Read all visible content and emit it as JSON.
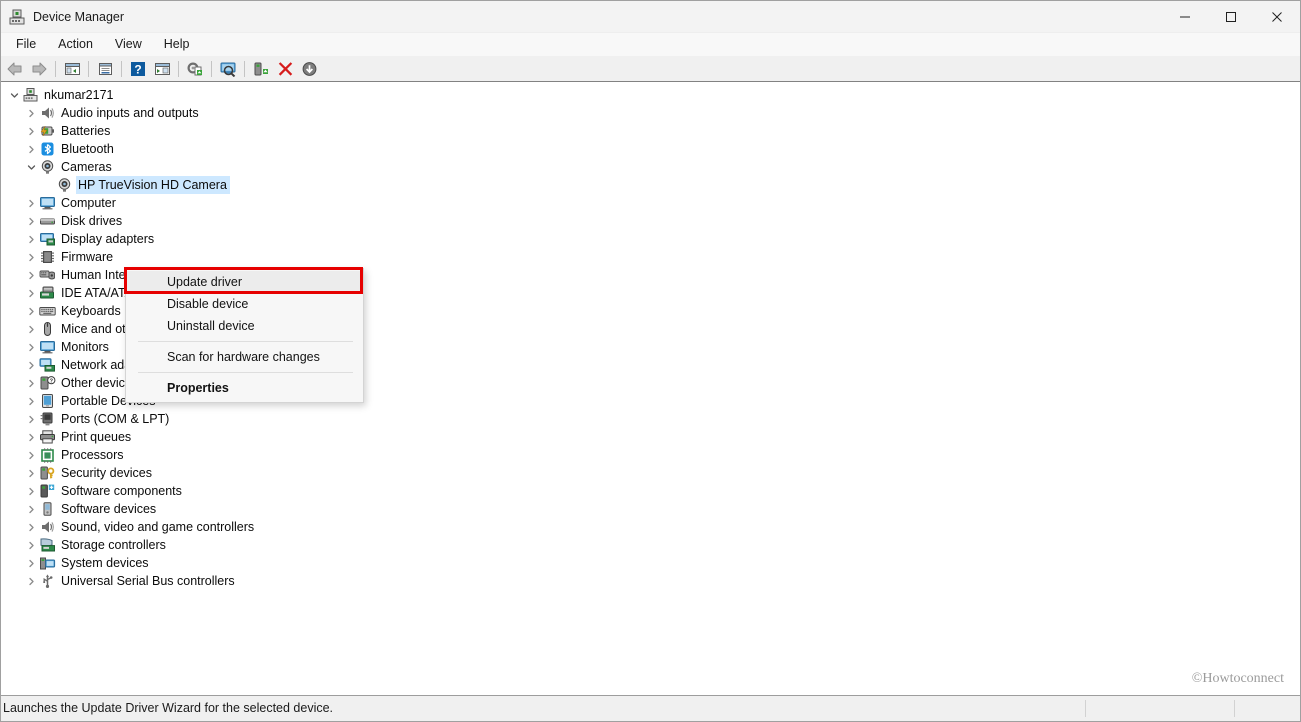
{
  "window": {
    "title": "Device Manager",
    "title_icon": "device-manager-icon",
    "minimize_label": "Minimize",
    "maximize_label": "Maximize",
    "close_label": "Close"
  },
  "menubar": {
    "items": [
      {
        "label": "File"
      },
      {
        "label": "Action"
      },
      {
        "label": "View"
      },
      {
        "label": "Help"
      }
    ]
  },
  "toolbar": {
    "items": [
      {
        "name": "back-arrow-icon",
        "tooltip": "Back"
      },
      {
        "name": "forward-arrow-icon",
        "tooltip": "Forward"
      },
      {
        "name": "separator"
      },
      {
        "name": "show-hide-console-tree-icon",
        "tooltip": "Show/Hide Console Tree"
      },
      {
        "name": "separator"
      },
      {
        "name": "properties-icon",
        "tooltip": "Properties"
      },
      {
        "name": "separator"
      },
      {
        "name": "help-icon",
        "tooltip": "Help"
      },
      {
        "name": "show-hide-action-pane-icon",
        "tooltip": "Show/Hide Action Pane"
      },
      {
        "name": "separator"
      },
      {
        "name": "update-driver-icon",
        "tooltip": "Update Driver Software"
      },
      {
        "name": "separator"
      },
      {
        "name": "scan-for-hardware-changes-icon",
        "tooltip": "Scan for hardware changes"
      },
      {
        "name": "separator"
      },
      {
        "name": "enable-device-icon",
        "tooltip": "Enable device"
      },
      {
        "name": "uninstall-device-icon",
        "tooltip": "Uninstall device"
      },
      {
        "name": "disable-device-icon",
        "tooltip": "Disable device"
      }
    ]
  },
  "tree": {
    "nodes": [
      {
        "label": "nkumar2171",
        "depth": 0,
        "twisty": "expanded",
        "icon": "computer-root-icon",
        "selected": false
      },
      {
        "label": "Audio inputs and outputs",
        "depth": 1,
        "twisty": "collapsed",
        "icon": "speaker-icon",
        "selected": false
      },
      {
        "label": "Batteries",
        "depth": 1,
        "twisty": "collapsed",
        "icon": "battery-icon",
        "selected": false
      },
      {
        "label": "Bluetooth",
        "depth": 1,
        "twisty": "collapsed",
        "icon": "bluetooth-icon",
        "selected": false
      },
      {
        "label": "Cameras",
        "depth": 1,
        "twisty": "expanded",
        "icon": "camera-icon",
        "selected": false
      },
      {
        "label": "HP TrueVision HD Camera",
        "depth": 2,
        "twisty": "none",
        "icon": "camera-icon",
        "selected": true
      },
      {
        "label": "Computer",
        "depth": 1,
        "twisty": "collapsed",
        "icon": "monitor-icon",
        "selected": false
      },
      {
        "label": "Disk drives",
        "depth": 1,
        "twisty": "collapsed",
        "icon": "disk-drive-icon",
        "selected": false
      },
      {
        "label": "Display adapters",
        "depth": 1,
        "twisty": "collapsed",
        "icon": "display-adapter-icon",
        "selected": false
      },
      {
        "label": "Firmware",
        "depth": 1,
        "twisty": "collapsed",
        "icon": "firmware-chip-icon",
        "selected": false
      },
      {
        "label": "Human Interface Devices",
        "depth": 1,
        "twisty": "collapsed",
        "icon": "hid-icon",
        "selected": false
      },
      {
        "label": "IDE ATA/ATAPI controllers",
        "depth": 1,
        "twisty": "collapsed",
        "icon": "ide-controller-icon",
        "selected": false
      },
      {
        "label": "Keyboards",
        "depth": 1,
        "twisty": "collapsed",
        "icon": "keyboard-icon",
        "selected": false
      },
      {
        "label": "Mice and other pointing devices",
        "depth": 1,
        "twisty": "collapsed",
        "icon": "mouse-icon",
        "selected": false
      },
      {
        "label": "Monitors",
        "depth": 1,
        "twisty": "collapsed",
        "icon": "monitor-icon",
        "selected": false
      },
      {
        "label": "Network adapters",
        "depth": 1,
        "twisty": "collapsed",
        "icon": "network-adapter-icon",
        "selected": false
      },
      {
        "label": "Other devices",
        "depth": 1,
        "twisty": "collapsed",
        "icon": "other-device-icon",
        "selected": false
      },
      {
        "label": "Portable Devices",
        "depth": 1,
        "twisty": "collapsed",
        "icon": "portable-device-icon",
        "selected": false
      },
      {
        "label": "Ports (COM & LPT)",
        "depth": 1,
        "twisty": "collapsed",
        "icon": "port-icon",
        "selected": false
      },
      {
        "label": "Print queues",
        "depth": 1,
        "twisty": "collapsed",
        "icon": "printer-icon",
        "selected": false
      },
      {
        "label": "Processors",
        "depth": 1,
        "twisty": "collapsed",
        "icon": "processor-icon",
        "selected": false
      },
      {
        "label": "Security devices",
        "depth": 1,
        "twisty": "collapsed",
        "icon": "security-device-icon",
        "selected": false
      },
      {
        "label": "Software components",
        "depth": 1,
        "twisty": "collapsed",
        "icon": "software-component-icon",
        "selected": false
      },
      {
        "label": "Software devices",
        "depth": 1,
        "twisty": "collapsed",
        "icon": "software-device-icon",
        "selected": false
      },
      {
        "label": "Sound, video and game controllers",
        "depth": 1,
        "twisty": "collapsed",
        "icon": "speaker-icon",
        "selected": false
      },
      {
        "label": "Storage controllers",
        "depth": 1,
        "twisty": "collapsed",
        "icon": "storage-controller-icon",
        "selected": false
      },
      {
        "label": "System devices",
        "depth": 1,
        "twisty": "collapsed",
        "icon": "system-device-icon",
        "selected": false
      },
      {
        "label": "Universal Serial Bus controllers",
        "depth": 1,
        "twisty": "collapsed",
        "icon": "usb-icon",
        "selected": false
      }
    ]
  },
  "context_menu": {
    "items": [
      {
        "label": "Update driver",
        "type": "item",
        "bold": false,
        "highlighted": true
      },
      {
        "label": "Disable device",
        "type": "item",
        "bold": false,
        "highlighted": false
      },
      {
        "label": "Uninstall device",
        "type": "item",
        "bold": false,
        "highlighted": false
      },
      {
        "label": "",
        "type": "separator"
      },
      {
        "label": "Scan for hardware changes",
        "type": "item",
        "bold": false,
        "highlighted": false
      },
      {
        "label": "",
        "type": "separator"
      },
      {
        "label": "Properties",
        "type": "item",
        "bold": true,
        "highlighted": false
      }
    ],
    "highlight_color": "#e60000"
  },
  "statusbar": {
    "text": "Launches the Update Driver Wizard for the selected device."
  },
  "watermark": {
    "text": "©Howtoconnect"
  }
}
